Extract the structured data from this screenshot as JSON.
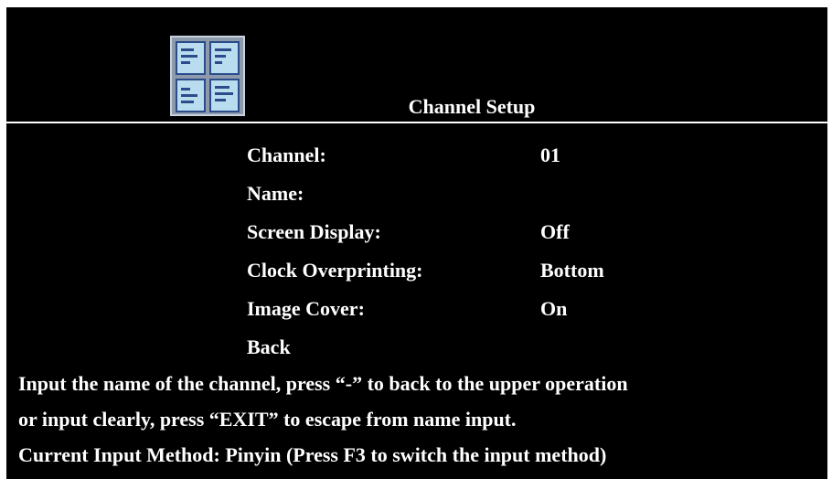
{
  "header": {
    "title": "Channel Setup",
    "icon": "channel-setup-icon"
  },
  "menu": {
    "items": [
      {
        "label": "Channel:",
        "value": "01"
      },
      {
        "label": "Name:",
        "value": ""
      },
      {
        "label": "Screen Display:",
        "value": "Off"
      },
      {
        "label": "Clock Overprinting:",
        "value": "Bottom"
      },
      {
        "label": "Image Cover:",
        "value": "On"
      },
      {
        "label": "Back",
        "value": ""
      }
    ]
  },
  "help": {
    "line1": "Input the name of the channel, press “-” to back to the upper operation",
    "line2": "or input clearly, press “EXIT” to escape from name input.",
    "line3": "Current Input Method: Pinyin (Press F3 to switch the input method)"
  },
  "colors": {
    "background": "#000000",
    "text": "#ffffff",
    "icon_frame": "#8d9aac",
    "icon_pane": "#b9dcef",
    "icon_ink": "#2b4b8a"
  }
}
